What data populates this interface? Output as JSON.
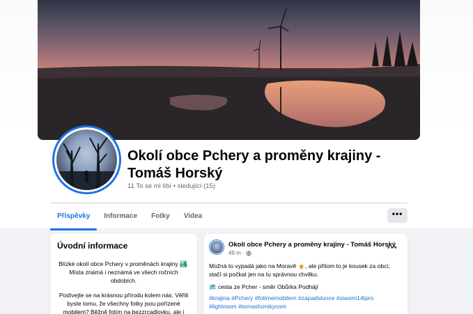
{
  "page": {
    "title": "Okolí obce Pchery a proměny krajiny - Tomáš Horský",
    "meta": "11 To se mi líbí • sledující (15)"
  },
  "tabs": [
    {
      "label": "Příspěvky",
      "active": true
    },
    {
      "label": "Informace",
      "active": false
    },
    {
      "label": "Fotky",
      "active": false
    },
    {
      "label": "Videa",
      "active": false
    }
  ],
  "more_label": "•••",
  "intro": {
    "heading": "Úvodní informace",
    "paragraph1": "Blízké okolí obce Pchery v proměnách krajiny 🏞️. Místa známá i neznámá ve všech ročních obdobích.",
    "paragraph2": "Podívejte se na krásnou přírodu kolem nás. Věřili byste tomu, že všechny fotky jsou pořízené mobilem? Běžně fotím na bezzrcadlovku, ale i"
  },
  "post": {
    "author": "Okolí obce Pchery a proměny krajiny - Tomáš Horský",
    "time": "49 m ·",
    "menu": "•••",
    "text1": "Možná to vypadá jako na Moravě 🍺, ale přitom to je kousek za obcí, stačí si počkat jen na tu správnou chvilku.",
    "text2": "🗺️ cesta ze Pcher - směr Obůrka Podhájí",
    "hashtags": "#krajina #Pchery #fotimemobilem #zapadslunce #xiaomi14tpro #lightroom #tomashorskycom"
  },
  "colors": {
    "accent": "#1b74e4",
    "link": "#216fdb",
    "muted": "#65676b"
  }
}
